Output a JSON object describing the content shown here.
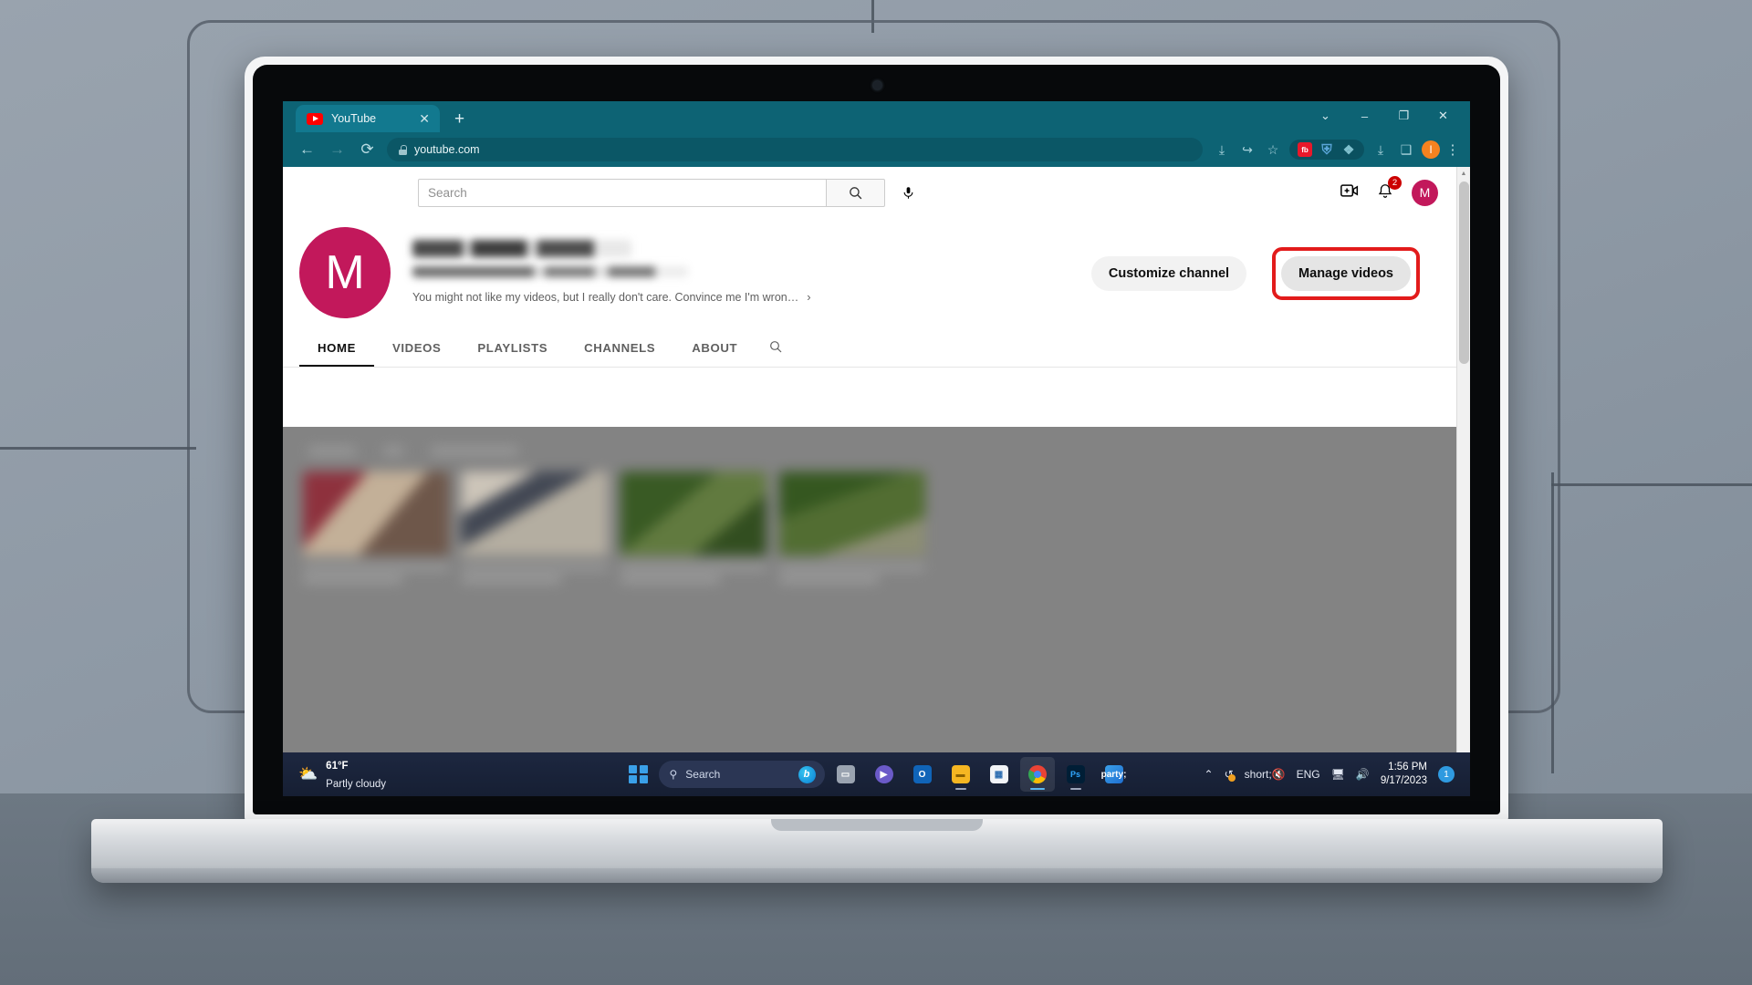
{
  "browser": {
    "tab": {
      "title": "YouTube",
      "favicon": "youtube-logo-icon",
      "close": "✕"
    },
    "newtab_label": "+",
    "window_controls": {
      "tabsearch": "⌄",
      "minimize": "–",
      "maximize": "❐",
      "close": "✕"
    },
    "nav": {
      "back": "←",
      "forward": "→",
      "reload": "⟳"
    },
    "omnibox": {
      "url": "youtube.com",
      "lock_icon": "lock-icon"
    },
    "toolbar_icons": {
      "install": "⤓",
      "share": "↪",
      "bookmark": "☆",
      "extensions": [
        {
          "name": "facebook-extension",
          "label": "fb",
          "color": "#e8182a"
        },
        {
          "name": "shield-extension",
          "label": "⛨",
          "color": "#5aa5d8"
        },
        {
          "name": "puzzle-extension",
          "label": "❖",
          "color": "#7fc0cd"
        }
      ],
      "downloads": "⤓",
      "sidepanel": "❑",
      "profile_initial": "I",
      "menu": "⋮"
    }
  },
  "youtube": {
    "search": {
      "placeholder": "Search",
      "button_icon": "search-icon",
      "mic_icon": "microphone-icon"
    },
    "header_icons": {
      "create": "create-video-icon",
      "notifications": {
        "icon": "bell-icon",
        "badge": "2"
      },
      "avatar_initial": "M"
    },
    "channel": {
      "avatar_initial": "M",
      "name_redacted": true,
      "handle_redacted": true,
      "description": "You might not like my videos, but I really don't care. Convince me I'm wron…",
      "expand_icon": "›"
    },
    "actions": {
      "customize": "Customize channel",
      "manage": "Manage videos",
      "highlight_color": "#e21b1b"
    },
    "tabs": [
      {
        "label": "HOME",
        "active": true
      },
      {
        "label": "VIDEOS",
        "active": false
      },
      {
        "label": "PLAYLISTS",
        "active": false
      },
      {
        "label": "CHANNELS",
        "active": false
      },
      {
        "label": "ABOUT",
        "active": false
      }
    ],
    "tab_search_icon": "search-icon",
    "content_blurred": true,
    "accent_color": "#c2185b"
  },
  "taskbar": {
    "weather": {
      "temperature": "61°F",
      "condition": "Partly cloudy",
      "icon": "partly-cloudy-icon"
    },
    "start": "start-icon",
    "search": {
      "placeholder": "Search",
      "bing_icon": "bing-icon"
    },
    "apps": [
      {
        "name": "task-view",
        "label": "❐"
      },
      {
        "name": "teams",
        "label": "▶"
      },
      {
        "name": "outlook",
        "label": "O"
      },
      {
        "name": "file-explorer",
        "label": "▭"
      },
      {
        "name": "microsoft-store",
        "label": "☰"
      },
      {
        "name": "google-chrome",
        "label": "●",
        "active": true
      },
      {
        "name": "photoshop",
        "label": "Ps"
      },
      {
        "name": "photos",
        "label": "◰"
      }
    ],
    "tray": {
      "overflow": "⌃",
      "onedrive": "onedrive-sync-icon",
      "microphone_muted": "mic-muted-icon",
      "language": "ENG",
      "network": "network-icon",
      "volume": "volume-icon",
      "time": "1:56 PM",
      "date": "9/17/2023",
      "notification_count": "1"
    }
  }
}
